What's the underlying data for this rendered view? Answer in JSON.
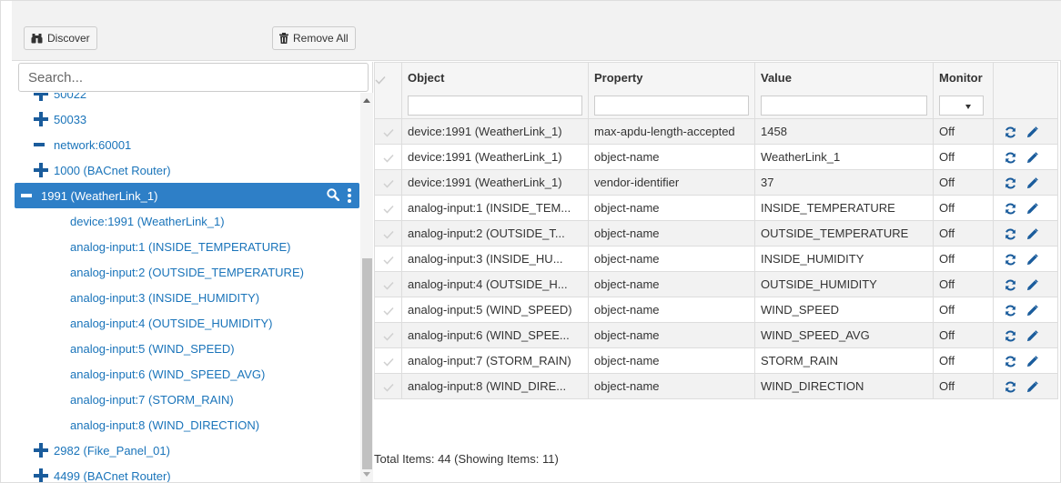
{
  "toolbar": {
    "discover_label": "Discover",
    "remove_all_label": "Remove All"
  },
  "search": {
    "placeholder": "Search..."
  },
  "tree": {
    "items": [
      {
        "label": "50022",
        "expander": "plus"
      },
      {
        "label": "50033",
        "expander": "plus"
      },
      {
        "label": "network:60001",
        "expander": "minus"
      },
      {
        "label": "1000 (BACnet Router)",
        "expander": "plus"
      },
      {
        "label": "1991 (WeatherLink_1)",
        "expander": "minus",
        "selected": true
      },
      {
        "label": "device:1991 (WeatherLink_1)",
        "expander": "none"
      },
      {
        "label": "analog-input:1 (INSIDE_TEMPERATURE)",
        "expander": "none"
      },
      {
        "label": "analog-input:2 (OUTSIDE_TEMPERATURE)",
        "expander": "none"
      },
      {
        "label": "analog-input:3 (INSIDE_HUMIDITY)",
        "expander": "none"
      },
      {
        "label": "analog-input:4 (OUTSIDE_HUMIDITY)",
        "expander": "none"
      },
      {
        "label": "analog-input:5 (WIND_SPEED)",
        "expander": "none"
      },
      {
        "label": "analog-input:6 (WIND_SPEED_AVG)",
        "expander": "none"
      },
      {
        "label": "analog-input:7 (STORM_RAIN)",
        "expander": "none"
      },
      {
        "label": "analog-input:8 (WIND_DIRECTION)",
        "expander": "none"
      },
      {
        "label": "2982 (Fike_Panel_01)",
        "expander": "plus"
      },
      {
        "label": "4499 (BACnet Router)",
        "expander": "plus"
      }
    ]
  },
  "grid": {
    "columns": [
      "Object",
      "Property",
      "Value",
      "Monitor"
    ],
    "rows": [
      {
        "object": "device:1991 (WeatherLink_1)",
        "property": "max-apdu-length-accepted",
        "value": "1458",
        "monitor": "Off"
      },
      {
        "object": "device:1991 (WeatherLink_1)",
        "property": "object-name",
        "value": "WeatherLink_1",
        "monitor": "Off"
      },
      {
        "object": "device:1991 (WeatherLink_1)",
        "property": "vendor-identifier",
        "value": "37",
        "monitor": "Off"
      },
      {
        "object": "analog-input:1 (INSIDE_TEM...",
        "property": "object-name",
        "value": "INSIDE_TEMPERATURE",
        "monitor": "Off"
      },
      {
        "object": "analog-input:2 (OUTSIDE_T...",
        "property": "object-name",
        "value": "OUTSIDE_TEMPERATURE",
        "monitor": "Off"
      },
      {
        "object": "analog-input:3 (INSIDE_HU...",
        "property": "object-name",
        "value": "INSIDE_HUMIDITY",
        "monitor": "Off"
      },
      {
        "object": "analog-input:4 (OUTSIDE_H...",
        "property": "object-name",
        "value": "OUTSIDE_HUMIDITY",
        "monitor": "Off"
      },
      {
        "object": "analog-input:5 (WIND_SPEED)",
        "property": "object-name",
        "value": "WIND_SPEED",
        "monitor": "Off"
      },
      {
        "object": "analog-input:6 (WIND_SPEE...",
        "property": "object-name",
        "value": "WIND_SPEED_AVG",
        "monitor": "Off"
      },
      {
        "object": "analog-input:7 (STORM_RAIN)",
        "property": "object-name",
        "value": "STORM_RAIN",
        "monitor": "Off"
      },
      {
        "object": "analog-input:8 (WIND_DIRE...",
        "property": "object-name",
        "value": "WIND_DIRECTION",
        "monitor": "Off"
      }
    ],
    "footer": "Total Items: 44 (Showing Items: 11)"
  },
  "icons": {
    "discover": "binoculars-icon",
    "remove_all": "trash-icon",
    "row_refresh": "refresh-icon",
    "row_edit": "pencil-icon",
    "selected_search": "search-icon",
    "selected_menu": "kebab-menu-icon",
    "row_select": "check-icon"
  },
  "colors": {
    "link": "#1a74ba",
    "selected_bg": "#2e7fc7",
    "action_icon": "#1a5c9c",
    "row_alt": "#f2f2f2",
    "header_bg": "#f5f5f5"
  }
}
